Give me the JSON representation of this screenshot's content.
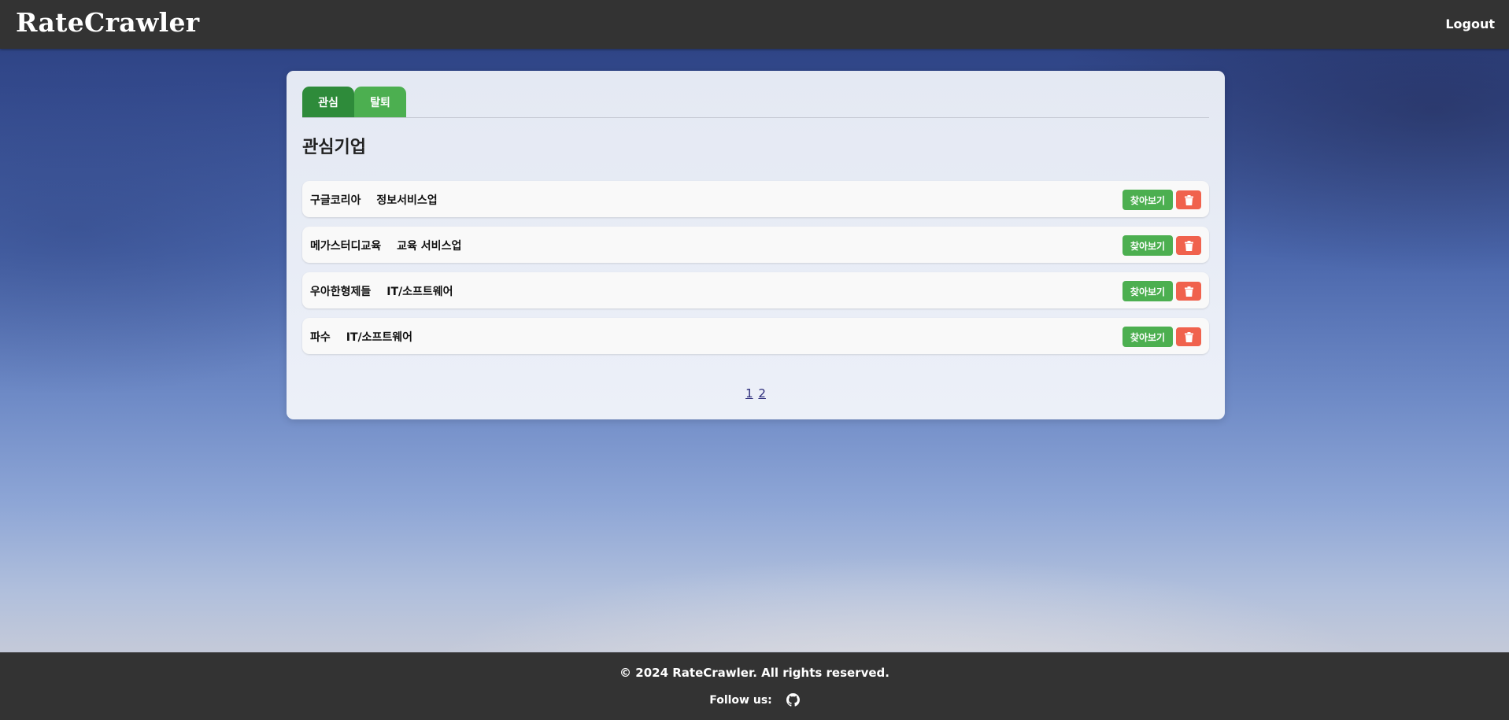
{
  "header": {
    "brand": "RateCrawler",
    "logout_label": "Logout"
  },
  "tabs": [
    {
      "label": "관심",
      "active": true
    },
    {
      "label": "탈퇴",
      "active": false
    }
  ],
  "section_title": "관심기업",
  "companies": [
    {
      "name": "구글코리아",
      "industry": "정보서비스업",
      "view_label": "찾아보기"
    },
    {
      "name": "메가스터디교육",
      "industry": "교육 서비스업",
      "view_label": "찾아보기"
    },
    {
      "name": "우아한형제들",
      "industry": "IT/소프트웨어",
      "view_label": "찾아보기"
    },
    {
      "name": "파수",
      "industry": "IT/소프트웨어",
      "view_label": "찾아보기"
    }
  ],
  "pagination": {
    "pages": [
      "1",
      "2"
    ]
  },
  "footer": {
    "copyright": "© 2024 RateCrawler. All rights reserved.",
    "follow_label": "Follow us:"
  },
  "colors": {
    "header_bg": "#333333",
    "tab_active": "#2e8b3a",
    "tab_inactive": "#4caf50",
    "view_button": "#4caf50",
    "delete_button": "#f0624d"
  },
  "icons": {
    "delete": "trash-icon",
    "social": "github-icon"
  }
}
